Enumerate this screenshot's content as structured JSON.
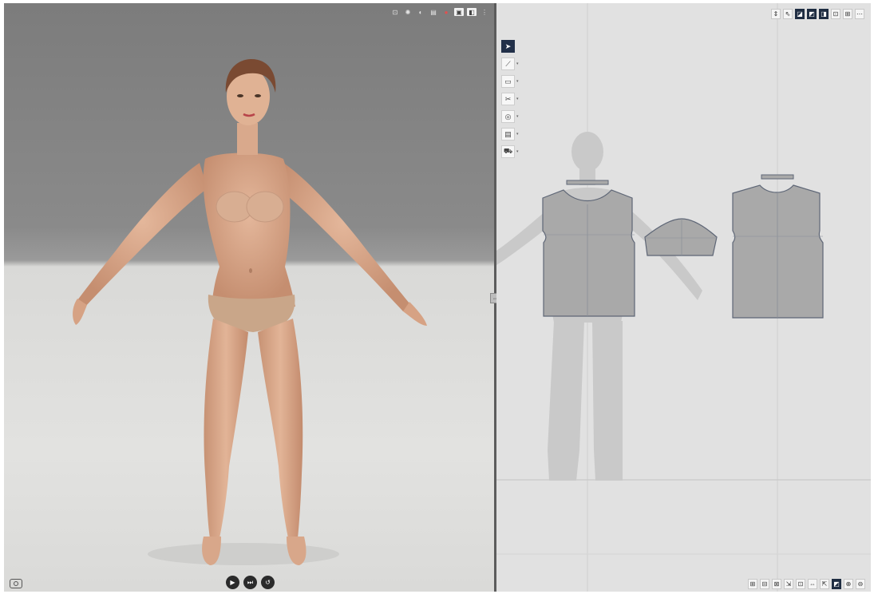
{
  "viewport3d": {
    "toolbar_icons": [
      "grid-icon",
      "light-icon",
      "display-icon",
      "texture-icon",
      "color-icon",
      "avatar-visibility-icon",
      "garment-visibility-icon",
      "more-icon"
    ],
    "playback": {
      "play_icon": "▶",
      "step_icon": "⏭",
      "reset_icon": "↺"
    },
    "camera_icon": "camera-icon"
  },
  "divider_handle": "⇔",
  "pattern2d": {
    "top_toolbar": [
      {
        "icon": "⇕",
        "name": "zoom-fit-icon",
        "active": false
      },
      {
        "icon": "⇖",
        "name": "select-mesh-icon",
        "active": false
      },
      {
        "icon": "◪",
        "name": "avatar-silhouette-icon",
        "active": true
      },
      {
        "icon": "◩",
        "name": "pattern-fill-icon",
        "active": true
      },
      {
        "icon": "◨",
        "name": "grid-display-icon",
        "active": true
      },
      {
        "icon": "⊡",
        "name": "arrangement-icon",
        "active": false
      },
      {
        "icon": "⊞",
        "name": "layout-icon",
        "active": false
      },
      {
        "icon": "⋯",
        "name": "more-options-icon",
        "active": false
      }
    ],
    "tools": [
      {
        "icon": "➤",
        "name": "select-tool-icon",
        "active": true,
        "has_menu": false
      },
      {
        "icon": "⟋",
        "name": "line-tool-icon",
        "active": false,
        "has_menu": true
      },
      {
        "icon": "▭",
        "name": "rectangle-tool-icon",
        "active": false,
        "has_menu": true
      },
      {
        "icon": "✂",
        "name": "sewing-tool-icon",
        "active": false,
        "has_menu": true
      },
      {
        "icon": "◎",
        "name": "circle-tool-icon",
        "active": false,
        "has_menu": true
      },
      {
        "icon": "▤",
        "name": "pleat-tool-icon",
        "active": false,
        "has_menu": true
      },
      {
        "icon": "⛟",
        "name": "button-tool-icon",
        "active": false,
        "has_menu": true
      }
    ],
    "bottom_toolbar": [
      {
        "icon": "⊞",
        "name": "pattern-grid-icon",
        "active": false
      },
      {
        "icon": "⊟",
        "name": "pattern-layout-icon",
        "active": false
      },
      {
        "icon": "⊠",
        "name": "pattern-fit-icon",
        "active": false
      },
      {
        "icon": "⇲",
        "name": "pattern-scale-icon",
        "active": false
      },
      {
        "icon": "⊡",
        "name": "pattern-center-icon",
        "active": false
      },
      {
        "icon": "⇔",
        "name": "pattern-mirror-icon",
        "active": false
      },
      {
        "icon": "⇱",
        "name": "pattern-move-icon",
        "active": false
      },
      {
        "icon": "◩",
        "name": "pattern-view-icon",
        "active": true
      },
      {
        "icon": "⊕",
        "name": "zoom-in-icon",
        "active": false
      },
      {
        "icon": "⊖",
        "name": "zoom-out-icon",
        "active": false
      }
    ],
    "status_text": "",
    "colors": {
      "pattern_fill": "#a9a9a9",
      "pattern_stroke": "#5e6676",
      "avatar_silhouette": "#c9c9c9",
      "grid_line": "#cfcfcf"
    }
  },
  "colors": {
    "active_tool": "#223049",
    "skin": "#d9a98c",
    "underwear": "#c9a689"
  }
}
